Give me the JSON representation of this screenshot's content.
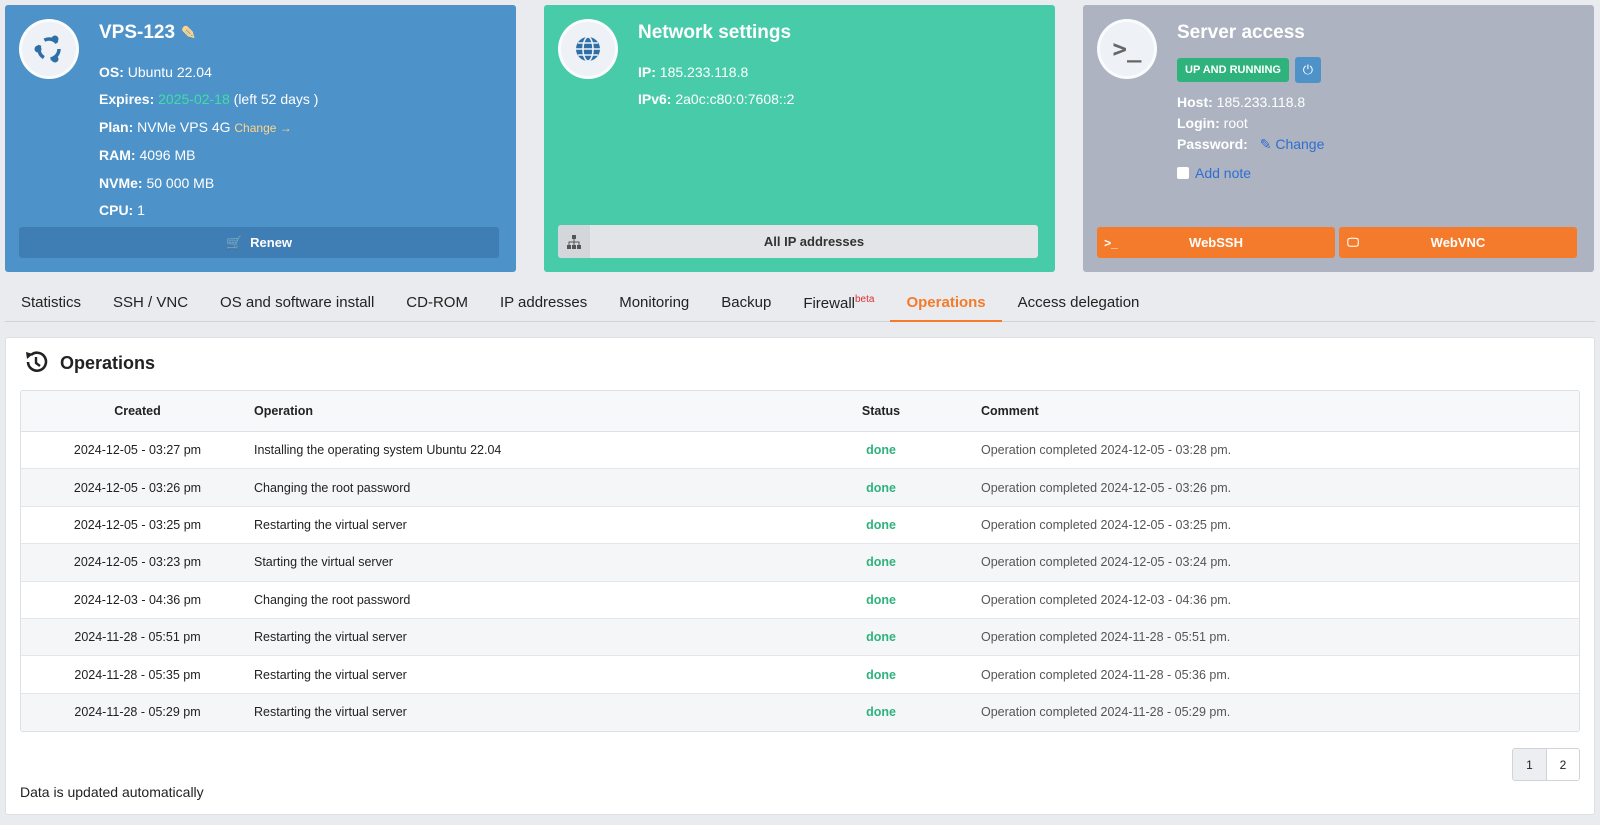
{
  "vps": {
    "name": "VPS-123",
    "os_label": "OS:",
    "os_value": "Ubuntu 22.04",
    "expires_label": "Expires:",
    "expires_date": "2025-02-18",
    "expires_left": "(left 52 days )",
    "plan_label": "Plan:",
    "plan_value": "NVMe VPS 4G",
    "plan_change": "Change",
    "ram_label": "RAM:",
    "ram_value": "4096 MB",
    "nvme_label": "NVMe:",
    "nvme_value": "50 000 MB",
    "cpu_label": "CPU:",
    "cpu_value": "1",
    "renew_label": "Renew",
    "colors": {
      "card": "#4d92c8",
      "expires_date": "#3de0a3"
    }
  },
  "network": {
    "title": "Network settings",
    "ip_label": "IP:",
    "ip_value": "185.233.118.8",
    "ipv6_label": "IPv6:",
    "ipv6_value": "2a0c:c80:0:7608::2",
    "all_ips_label": "All IP addresses",
    "colors": {
      "card": "#48cba9"
    }
  },
  "server": {
    "title": "Server access",
    "status_badge": "UP AND RUNNING",
    "power_icon": "power-icon",
    "host_label": "Host:",
    "host_value": "185.233.118.8",
    "login_label": "Login:",
    "login_value": "root",
    "password_label": "Password:",
    "password_change": "Change",
    "add_note": "Add note",
    "webssh_label": "WebSSH",
    "webvnc_label": "WebVNC",
    "colors": {
      "card": "#adb3c0",
      "button": "#f47b2b",
      "badge": "#2fb37c"
    }
  },
  "tabs": [
    {
      "label": "Statistics"
    },
    {
      "label": "SSH / VNC"
    },
    {
      "label": "OS and software install"
    },
    {
      "label": "CD-ROM"
    },
    {
      "label": "IP addresses"
    },
    {
      "label": "Monitoring"
    },
    {
      "label": "Backup"
    },
    {
      "label": "Firewall",
      "sup": "beta"
    },
    {
      "label": "Operations",
      "active": true
    },
    {
      "label": "Access delegation"
    }
  ],
  "operations": {
    "title": "Operations",
    "columns": {
      "created": "Created",
      "operation": "Operation",
      "status": "Status",
      "comment": "Comment"
    },
    "rows": [
      {
        "created": "2024-12-05 - 03:27 pm",
        "operation": "Installing the operating system Ubuntu 22.04",
        "status": "done",
        "comment": "Operation completed 2024-12-05 - 03:28 pm."
      },
      {
        "created": "2024-12-05 - 03:26 pm",
        "operation": "Changing the root password",
        "status": "done",
        "comment": "Operation completed 2024-12-05 - 03:26 pm."
      },
      {
        "created": "2024-12-05 - 03:25 pm",
        "operation": "Restarting the virtual server",
        "status": "done",
        "comment": "Operation completed 2024-12-05 - 03:25 pm."
      },
      {
        "created": "2024-12-05 - 03:23 pm",
        "operation": "Starting the virtual server",
        "status": "done",
        "comment": "Operation completed 2024-12-05 - 03:24 pm."
      },
      {
        "created": "2024-12-03 - 04:36 pm",
        "operation": "Changing the root password",
        "status": "done",
        "comment": "Operation completed 2024-12-03 - 04:36 pm."
      },
      {
        "created": "2024-11-28 - 05:51 pm",
        "operation": "Restarting the virtual server",
        "status": "done",
        "comment": "Operation completed 2024-11-28 - 05:51 pm."
      },
      {
        "created": "2024-11-28 - 05:35 pm",
        "operation": "Restarting the virtual server",
        "status": "done",
        "comment": "Operation completed 2024-11-28 - 05:36 pm."
      },
      {
        "created": "2024-11-28 - 05:29 pm",
        "operation": "Restarting the virtual server",
        "status": "done",
        "comment": "Operation completed 2024-11-28 - 05:29 pm."
      }
    ],
    "pages": [
      "1",
      "2"
    ],
    "current_page": "1",
    "footer_note": "Data is updated automatically"
  }
}
